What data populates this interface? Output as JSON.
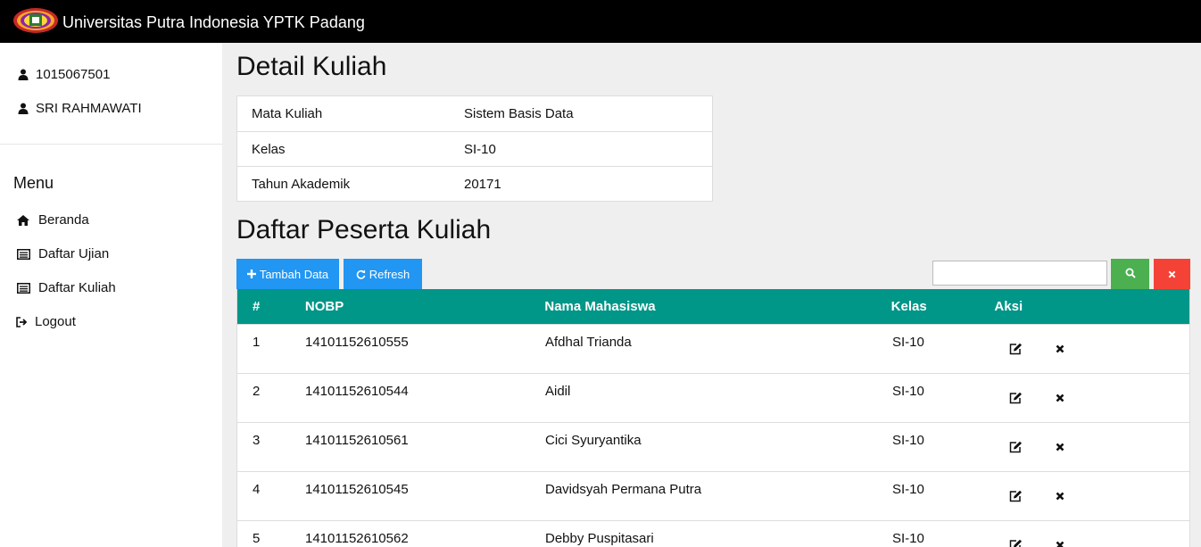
{
  "header": {
    "title": "Universitas Putra Indonesia YPTK Padang",
    "logo_icon": "university-logo"
  },
  "user": {
    "id": "1015067501",
    "name": "SRI RAHMAWATI",
    "icon": "user-icon"
  },
  "menu": {
    "heading": "Menu",
    "items": [
      {
        "label": "Beranda",
        "icon": "home-icon"
      },
      {
        "label": "Daftar Ujian",
        "icon": "list-icon"
      },
      {
        "label": "Daftar Kuliah",
        "icon": "list-icon"
      },
      {
        "label": "Logout",
        "icon": "logout-icon"
      }
    ]
  },
  "detail": {
    "title": "Detail Kuliah",
    "rows": [
      {
        "key": "Mata Kuliah",
        "value": "Sistem Basis Data"
      },
      {
        "key": "Kelas",
        "value": "SI-10"
      },
      {
        "key": "Tahun Akademik",
        "value": "20171"
      }
    ]
  },
  "peserta": {
    "title": "Daftar Peserta Kuliah",
    "add_label": "Tambah Data",
    "refresh_label": "Refresh",
    "search": {
      "value": "",
      "placeholder": ""
    },
    "columns": [
      "#",
      "NOBP",
      "Nama Mahasiswa",
      "Kelas",
      "Aksi"
    ],
    "rows": [
      {
        "no": "1",
        "nobp": "14101152610555",
        "nama": "Afdhal Trianda",
        "kelas": "SI-10"
      },
      {
        "no": "2",
        "nobp": "14101152610544",
        "nama": "Aidil",
        "kelas": "SI-10"
      },
      {
        "no": "3",
        "nobp": "14101152610561",
        "nama": "Cici Syuryantika",
        "kelas": "SI-10"
      },
      {
        "no": "4",
        "nobp": "14101152610545",
        "nama": "Davidsyah Permana Putra",
        "kelas": "SI-10"
      },
      {
        "no": "5",
        "nobp": "14101152610562",
        "nama": "Debby Puspitasari",
        "kelas": "SI-10"
      }
    ]
  },
  "colors": {
    "topbar": "#000000",
    "table_header": "#009688",
    "primary_button": "#2196f3",
    "search_button": "#4caf50",
    "clear_button": "#f44336"
  }
}
